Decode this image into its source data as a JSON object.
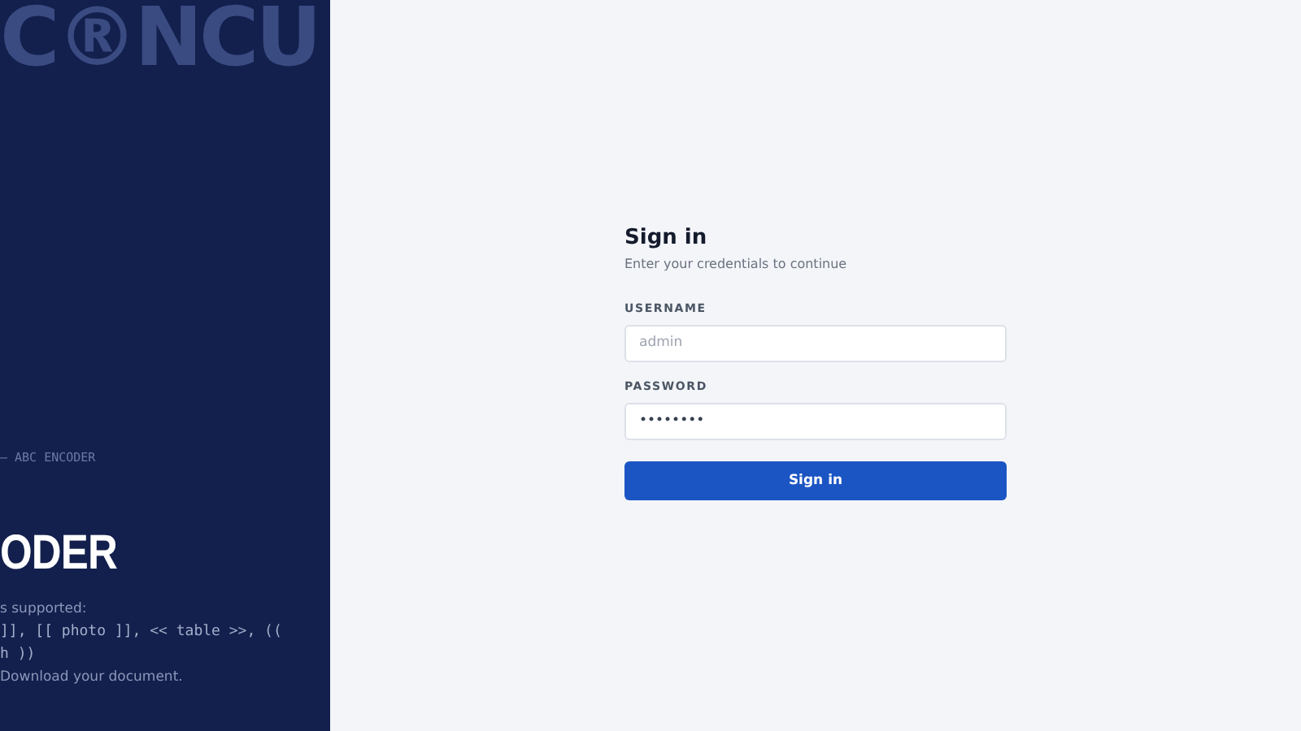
{
  "brand_panel": {
    "backdrop_text": "C®NCU",
    "eyebrow": "– ABC ENCODER",
    "heading": "ODER",
    "lines": [
      "s supported:",
      "]], [[ photo ]], << table >>, ((",
      "h ))",
      "Download your document."
    ]
  },
  "form": {
    "title": "Sign in",
    "subtitle": "Enter your credentials to continue",
    "fields": [
      {
        "label": "USERNAME",
        "placeholder": "admin"
      },
      {
        "label": "PASSWORD",
        "value": "••••••••"
      }
    ],
    "submit": "Sign in"
  }
}
